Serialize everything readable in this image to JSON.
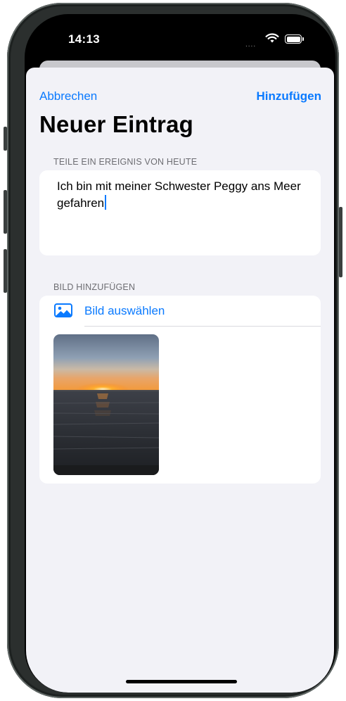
{
  "status_bar": {
    "time": "14:13",
    "signal": "....",
    "icons": [
      "wifi-icon",
      "battery-icon"
    ]
  },
  "nav": {
    "cancel_label": "Abbrechen",
    "add_label": "Hinzufügen"
  },
  "title": "Neuer Eintrag",
  "event_section": {
    "header": "TEILE EIN EREIGNIS VON HEUTE",
    "text_value": "Ich bin mit meiner Schwester Peggy ans Meer gefahren"
  },
  "image_section": {
    "header": "BILD HINZUFÜGEN",
    "pick_label": "Bild auswählen",
    "pick_icon": "photo-icon",
    "selected_image": "sunset-over-sea-photo"
  },
  "colors": {
    "accent": "#0a7aff",
    "background": "#f2f2f7",
    "card": "#ffffff",
    "section_header": "#6d6d72"
  }
}
